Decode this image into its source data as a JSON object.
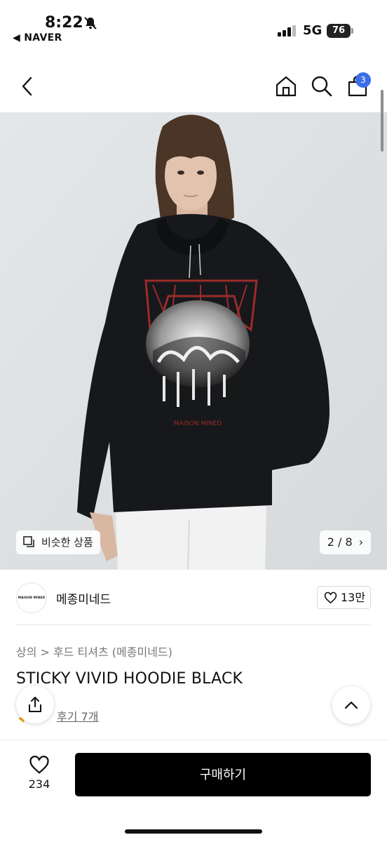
{
  "status_bar": {
    "time": "8:22",
    "back_app": "◀ NAVER",
    "network": "5G",
    "battery": "76"
  },
  "header": {
    "cart_count": "3",
    "icons": [
      "back-chevron-icon",
      "home-icon",
      "search-icon",
      "cart-icon"
    ]
  },
  "gallery": {
    "similar_label": "비슷한 상품",
    "pager": "2 / 8",
    "print_text": "MAISON MINED"
  },
  "brand": {
    "logo_text": "MAISON MINED",
    "name": "메종미네드",
    "likes": "13만"
  },
  "product": {
    "breadcrumb": "상의 > 후드 티셔츠 (메종미네드)",
    "title": "STICKY VIVID HOODIE BLACK",
    "reviews": "후기 7개"
  },
  "bottom_bar": {
    "wish_count": "234",
    "buy_label": "구매하기"
  },
  "colors": {
    "accent_badge": "#3b6fe8",
    "buy_button": "#000000",
    "background": "#ffffff"
  }
}
